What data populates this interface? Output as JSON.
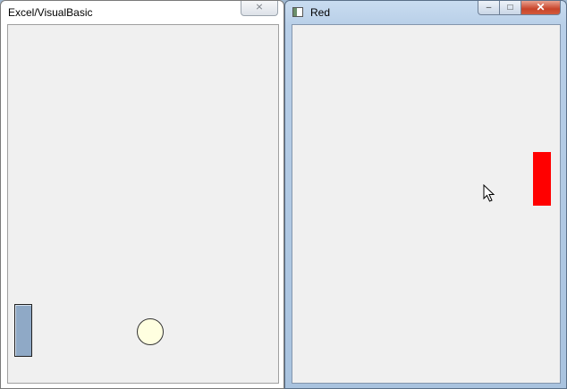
{
  "left_window": {
    "title": "Excel/VisualBasic",
    "close_label": "⨯"
  },
  "right_window": {
    "title": "Red",
    "minimize_label": "–",
    "maximize_label": "□",
    "close_label": "✕"
  },
  "game": {
    "paddle_left_color": "#8fa9c6",
    "ball_color": "#ffffe0",
    "paddle_right_color": "#ff0000"
  },
  "cursor": {
    "icon": "arrow-cursor-icon"
  }
}
